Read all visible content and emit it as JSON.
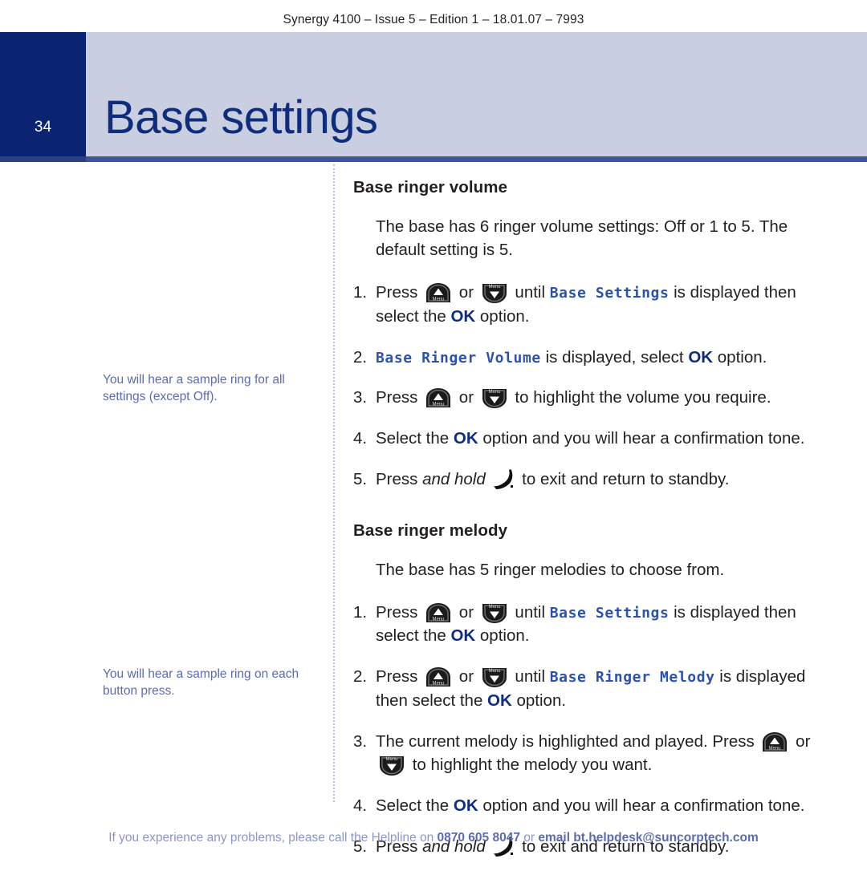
{
  "running_header": "Synergy 4100 – Issue 5 – Edition 1 – 18.01.07 – 7993",
  "banner": {
    "page_number": "34",
    "title": "Base settings",
    "tab_color": "#0a2472",
    "band_color": "#c9cfe0",
    "title_color": "#0f2d7d",
    "rule_color": "#3c5498"
  },
  "notes": [
    {
      "text": "You will hear a sample ring for all settings (except Off)."
    },
    {
      "text": "You will hear a sample ring on each button press."
    }
  ],
  "note_color": "#5c6bb0",
  "sections": [
    {
      "title": "Base ringer volume",
      "intro": "The base has 6 ringer volume settings: Off or 1 to 5. The default setting is 5.",
      "steps": [
        {
          "num": "1.",
          "parts": [
            {
              "t": "text",
              "v": "Press "
            },
            {
              "t": "icon",
              "v": "menu-up-key"
            },
            {
              "t": "text",
              "v": " or "
            },
            {
              "t": "icon",
              "v": "menu-down-key"
            },
            {
              "t": "text",
              "v": " until "
            },
            {
              "t": "lcd",
              "v": "Base Settings"
            },
            {
              "t": "text",
              "v": " is displayed then select the "
            },
            {
              "t": "ok",
              "v": "OK"
            },
            {
              "t": "text",
              "v": " option."
            }
          ]
        },
        {
          "num": "2.",
          "parts": [
            {
              "t": "lcd",
              "v": "Base Ringer Volume"
            },
            {
              "t": "text",
              "v": " is displayed, select "
            },
            {
              "t": "ok",
              "v": "OK"
            },
            {
              "t": "text",
              "v": " option."
            }
          ]
        },
        {
          "num": "3.",
          "parts": [
            {
              "t": "text",
              "v": "Press "
            },
            {
              "t": "icon",
              "v": "menu-up-key"
            },
            {
              "t": "text",
              "v": " or "
            },
            {
              "t": "icon",
              "v": "menu-down-key"
            },
            {
              "t": "text",
              "v": " to highlight the volume you require."
            }
          ]
        },
        {
          "num": "4.",
          "parts": [
            {
              "t": "text",
              "v": "Select the "
            },
            {
              "t": "ok",
              "v": "OK"
            },
            {
              "t": "text",
              "v": " option and you will hear a confirmation tone."
            }
          ]
        },
        {
          "num": "5.",
          "parts": [
            {
              "t": "text",
              "v": "Press "
            },
            {
              "t": "ital",
              "v": "and hold"
            },
            {
              "t": "text",
              "v": " "
            },
            {
              "t": "icon",
              "v": "hangup-key"
            },
            {
              "t": "text",
              "v": " to exit and return to standby."
            }
          ]
        }
      ]
    },
    {
      "title": "Base ringer melody",
      "intro": "The base has 5 ringer melodies to choose from.",
      "steps": [
        {
          "num": "1.",
          "parts": [
            {
              "t": "text",
              "v": "Press "
            },
            {
              "t": "icon",
              "v": "menu-up-key"
            },
            {
              "t": "text",
              "v": " or "
            },
            {
              "t": "icon",
              "v": "menu-down-key"
            },
            {
              "t": "text",
              "v": " until "
            },
            {
              "t": "lcd",
              "v": "Base Settings"
            },
            {
              "t": "text",
              "v": " is displayed then select the "
            },
            {
              "t": "ok",
              "v": "OK"
            },
            {
              "t": "text",
              "v": " option."
            }
          ]
        },
        {
          "num": "2.",
          "parts": [
            {
              "t": "text",
              "v": "Press "
            },
            {
              "t": "icon",
              "v": "menu-up-key"
            },
            {
              "t": "text",
              "v": " or "
            },
            {
              "t": "icon",
              "v": "menu-down-key"
            },
            {
              "t": "text",
              "v": " until "
            },
            {
              "t": "lcd",
              "v": "Base Ringer Melody"
            },
            {
              "t": "text",
              "v": " is displayed then select the "
            },
            {
              "t": "ok",
              "v": "OK"
            },
            {
              "t": "text",
              "v": " option."
            }
          ]
        },
        {
          "num": "3.",
          "parts": [
            {
              "t": "text",
              "v": "The current melody is highlighted and played. Press "
            },
            {
              "t": "icon",
              "v": "menu-up-key"
            },
            {
              "t": "text",
              "v": " or "
            },
            {
              "t": "icon",
              "v": "menu-down-key"
            },
            {
              "t": "text",
              "v": " to highlight the melody you want."
            }
          ]
        },
        {
          "num": "4.",
          "parts": [
            {
              "t": "text",
              "v": "Select the "
            },
            {
              "t": "ok",
              "v": "OK"
            },
            {
              "t": "text",
              "v": " option and you will hear a confirmation tone."
            }
          ]
        },
        {
          "num": "5.",
          "parts": [
            {
              "t": "text",
              "v": "Press "
            },
            {
              "t": "ital",
              "v": "and hold"
            },
            {
              "t": "text",
              "v": " "
            },
            {
              "t": "icon",
              "v": "hangup-key"
            },
            {
              "t": "text",
              "v": " to exit and return to standby."
            }
          ]
        }
      ]
    }
  ],
  "key_label": "Menu",
  "footer": {
    "lead": "If you experience any problems, please call the Helpline on ",
    "phone": "0870 605 8047",
    "mid": " or ",
    "email": "email bt.helpdesk@suncorptech.com",
    "color": "#8a95c9"
  }
}
